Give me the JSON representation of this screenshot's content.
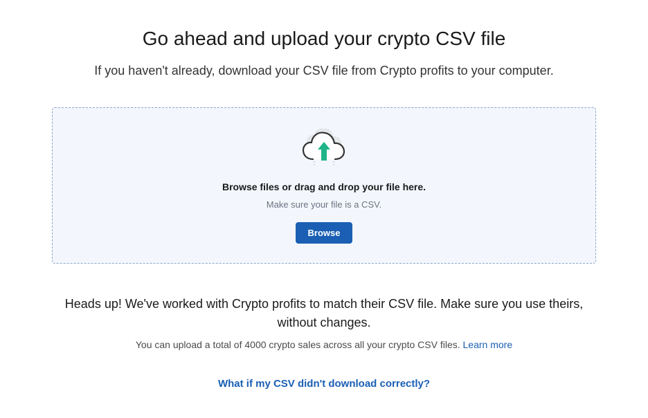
{
  "header": {
    "title": "Go ahead and upload your crypto CSV file",
    "subtitle": "If you haven't already, download your CSV file from Crypto profits to your computer."
  },
  "dropzone": {
    "title": "Browse files or drag and drop your file here.",
    "hint": "Make sure your file is a CSV.",
    "button_label": "Browse"
  },
  "footer": {
    "heads_up": "Heads up! We've worked with Crypto profits to match their CSV file. Make sure you use theirs, without changes.",
    "limit_text": "You can upload a total of 4000 crypto sales across all your crypto CSV files. ",
    "learn_more_label": "Learn more",
    "help_link_label": "What if my CSV didn't download correctly?"
  }
}
